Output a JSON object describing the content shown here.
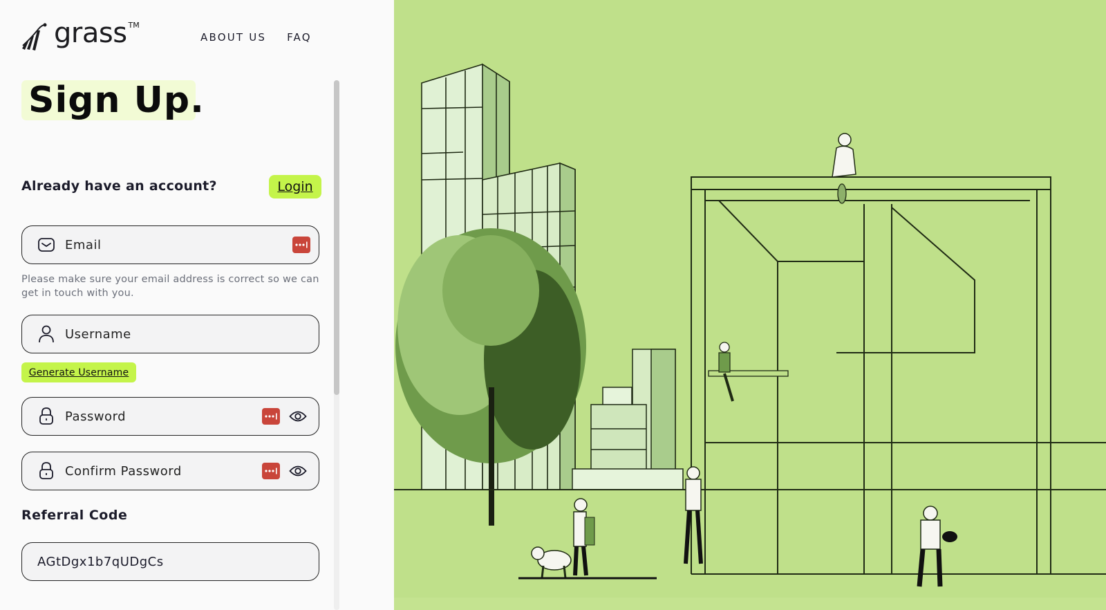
{
  "brand": {
    "name": "grass",
    "trademark": "TM"
  },
  "nav": {
    "items": [
      {
        "label": "ABOUT US"
      },
      {
        "label": "FAQ"
      }
    ]
  },
  "page": {
    "title": "Sign Up."
  },
  "account": {
    "prompt": "Already have an account?",
    "login_label": "Login"
  },
  "form": {
    "email": {
      "placeholder": "Email",
      "value": "",
      "hint": "Please make sure your email address is correct so we can get in touch with you."
    },
    "username": {
      "placeholder": "Username",
      "value": ""
    },
    "generate_username_label": "Generate Username",
    "password": {
      "placeholder": "Password",
      "value": ""
    },
    "confirm_password": {
      "placeholder": "Confirm Password",
      "value": ""
    },
    "referral": {
      "label": "Referral Code",
      "value": "AGtDgx1b7qUDgCs"
    }
  },
  "icons": {
    "email": "envelope-icon",
    "username": "user-icon",
    "password": "lock-icon",
    "password_manager": "password-manager-icon",
    "visibility": "eye-icon"
  },
  "colors": {
    "accent": "#c4f44a",
    "title_highlight": "#f2fbd5",
    "password_manager": "#c9453a",
    "illustration_bg": "#bfe08a"
  },
  "illustration": {
    "description": "Line-art city scene with tree, buildings, people and a dog on green background"
  }
}
